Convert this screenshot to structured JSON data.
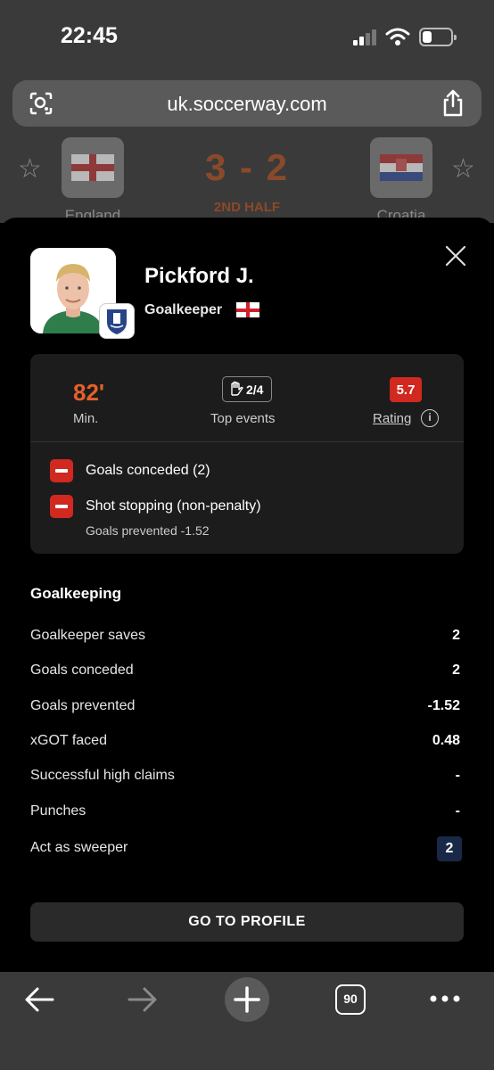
{
  "status": {
    "time": "22:45"
  },
  "browser": {
    "url": "uk.soccerway.com",
    "tab_count": "90"
  },
  "match": {
    "home_team": "England",
    "away_team": "Croatia",
    "score": "3 - 2",
    "period": "2ND HALF"
  },
  "player": {
    "name": "Pickford J.",
    "position": "Goalkeeper"
  },
  "summary": {
    "minutes": "82'",
    "minutes_label": "Min.",
    "top_events": "2/4",
    "top_events_label": "Top events",
    "rating": "5.7",
    "rating_label": "Rating",
    "rating_color": "#d1281f",
    "events": [
      {
        "label": "Goals conceded (2)",
        "detail": ""
      },
      {
        "label": "Shot stopping (non-penalty)",
        "detail": "Goals prevented -1.52"
      }
    ]
  },
  "goalkeeping": {
    "title": "Goalkeeping",
    "rows": [
      {
        "label": "Goalkeeper saves",
        "value": "2"
      },
      {
        "label": "Goals conceded",
        "value": "2"
      },
      {
        "label": "Goals prevented",
        "value": "-1.52"
      },
      {
        "label": "xGOT faced",
        "value": "0.48"
      },
      {
        "label": "Successful high claims",
        "value": "-"
      },
      {
        "label": "Punches",
        "value": "-"
      },
      {
        "label": "Act as sweeper",
        "value": "2"
      }
    ]
  },
  "actions": {
    "profile_button": "GO TO PROFILE"
  },
  "colors": {
    "accent_orange": "#e5602a",
    "negative_red": "#d1281f",
    "highlight_navy": "#1a2848"
  }
}
